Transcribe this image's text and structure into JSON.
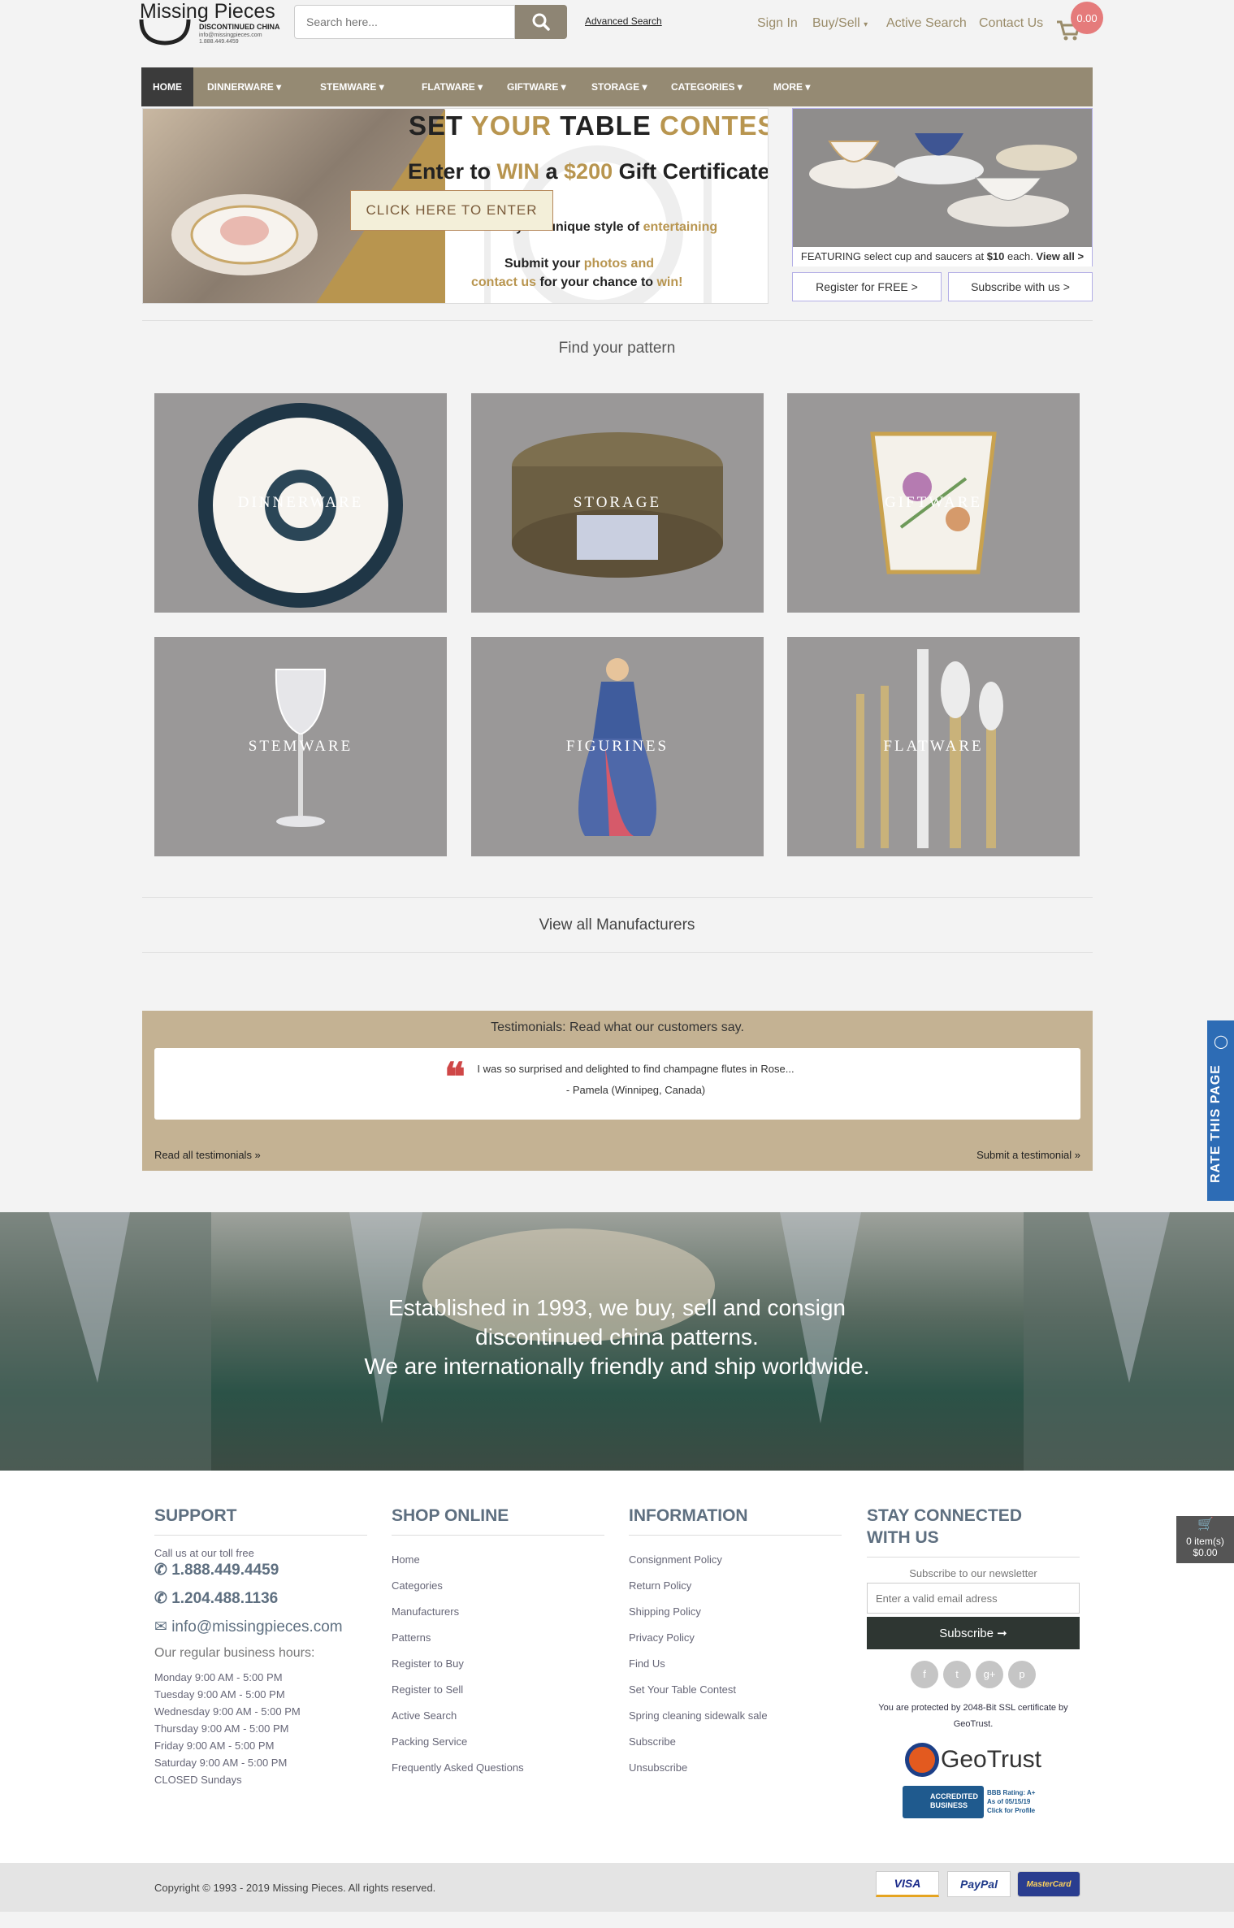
{
  "header": {
    "logo": {
      "title": "Missing Pieces",
      "subtitle": "DISCONTINUED CHINA",
      "email": "info@missingpieces.com",
      "phone": "1.888.449.4459"
    },
    "search_placeholder": "Search here...",
    "advanced_search": "Advanced Search",
    "links": [
      "Sign In",
      "Buy/Sell",
      "Active Search",
      "Contact Us"
    ],
    "cart_total": "0.00"
  },
  "nav": [
    "HOME",
    "DINNERWARE",
    "STEMWARE",
    "FLATWARE",
    "GIFTWARE",
    "STORAGE",
    "CATEGORIES",
    "MORE"
  ],
  "banner": {
    "line1_a": "SET ",
    "line1_b": "YOUR",
    "line1_c": " TABLE ",
    "line1_d": "CONTEST",
    "line2_a": "Enter to ",
    "line2_b": "WIN",
    "line2_c": " a ",
    "line2_d": "$200",
    "line2_e": " Gift Certificate",
    "line3_a": "Thrill us with your unique style of ",
    "line3_b": "entertaining",
    "line4_a": "Submit your ",
    "line4_b": "photos and",
    "line5_a": "contact us",
    "line5_b": " for your chance to ",
    "line5_c": "win!",
    "button": "CLICK HERE TO ENTER"
  },
  "featured": {
    "text_a": "FEATURING select cup and saucers at ",
    "price": "$10",
    "text_b": " each. ",
    "view_all": "View all >"
  },
  "register_btn": "Register for FREE >",
  "subscribe_btn": "Subscribe with us >",
  "find_pattern": "Find your pattern",
  "tiles": [
    "DINNERWARE",
    "STORAGE",
    "GIFTWARE",
    "STEMWARE",
    "FIGURINES",
    "FLATWARE"
  ],
  "view_all_manufacturers": "View all Manufacturers",
  "testimonials": {
    "heading": "Testimonials: Read what our customers say.",
    "quote": "I was so surprised and delighted to find champagne flutes in Rose...",
    "author": "- Pamela (Winnipeg, Canada)",
    "read_all": "Read all testimonials »",
    "submit": "Submit a testimonial »"
  },
  "hero": {
    "line1": "Established in 1993, we buy, sell and consign",
    "line2": "discontinued china patterns.",
    "line3": "We are internationally friendly and ship worldwide."
  },
  "footer": {
    "support": {
      "title": "SUPPORT",
      "call_text": "Call us at our toll free",
      "phone1": "1.888.449.4459",
      "phone2": "1.204.488.1136",
      "email": "info@missingpieces.com",
      "hours_title": "Our regular business hours:",
      "hours": [
        "Monday 9:00 AM - 5:00 PM",
        "Tuesday 9:00 AM - 5:00 PM",
        "Wednesday 9:00 AM - 5:00 PM",
        "Thursday 9:00 AM - 5:00 PM",
        "Friday 9:00 AM - 5:00 PM",
        "Saturday 9:00 AM - 5:00 PM",
        "CLOSED Sundays"
      ]
    },
    "shop": {
      "title": "SHOP ONLINE",
      "links": [
        "Home",
        "Categories",
        "Manufacturers",
        "Patterns",
        "Register to Buy",
        "Register to Sell",
        "Active Search",
        "Packing Service",
        "Frequently Asked Questions"
      ]
    },
    "info": {
      "title": "INFORMATION",
      "links": [
        "Consignment Policy",
        "Return Policy",
        "Shipping Policy",
        "Privacy Policy",
        "Find Us",
        "Set Your Table Contest",
        "Spring cleaning sidewalk sale",
        "Subscribe",
        "Unsubscribe"
      ]
    },
    "connect": {
      "title_l1": "STAY CONNECTED",
      "title_l2": "WITH US",
      "newsletter": "Subscribe to our newsletter",
      "email_placeholder": "Enter a valid email adress",
      "subscribe": "Subscribe ➞",
      "social": [
        "f",
        "t",
        "g+",
        "p"
      ],
      "ssl_l1": "You are protected by 2048-Bit SSL certificate by",
      "ssl_l2": "GeoTrust.",
      "geotrust": "GeoTrust",
      "bbb_l1": "ACCREDITED",
      "bbb_l2": "BUSINESS",
      "bbb_rating": "BBB Rating: A+",
      "bbb_asof": "As of 05/15/19",
      "bbb_click": "Click for Profile"
    },
    "copyright": "Copyright © 1993 - 2019 Missing Pieces. All rights reserved.",
    "payments": [
      "VISA",
      "PayPal",
      "MasterCard"
    ]
  },
  "rate_tab": "RATE THIS PAGE",
  "mini_cart": {
    "items": "0 item(s)",
    "total": "$0.00"
  },
  "colors": {
    "nav": "#958a73",
    "testimonial_bg": "#c4b293",
    "footer_heading": "#5e6f80",
    "banner_gold": "#b8954f",
    "badge": "#e57b7b"
  }
}
